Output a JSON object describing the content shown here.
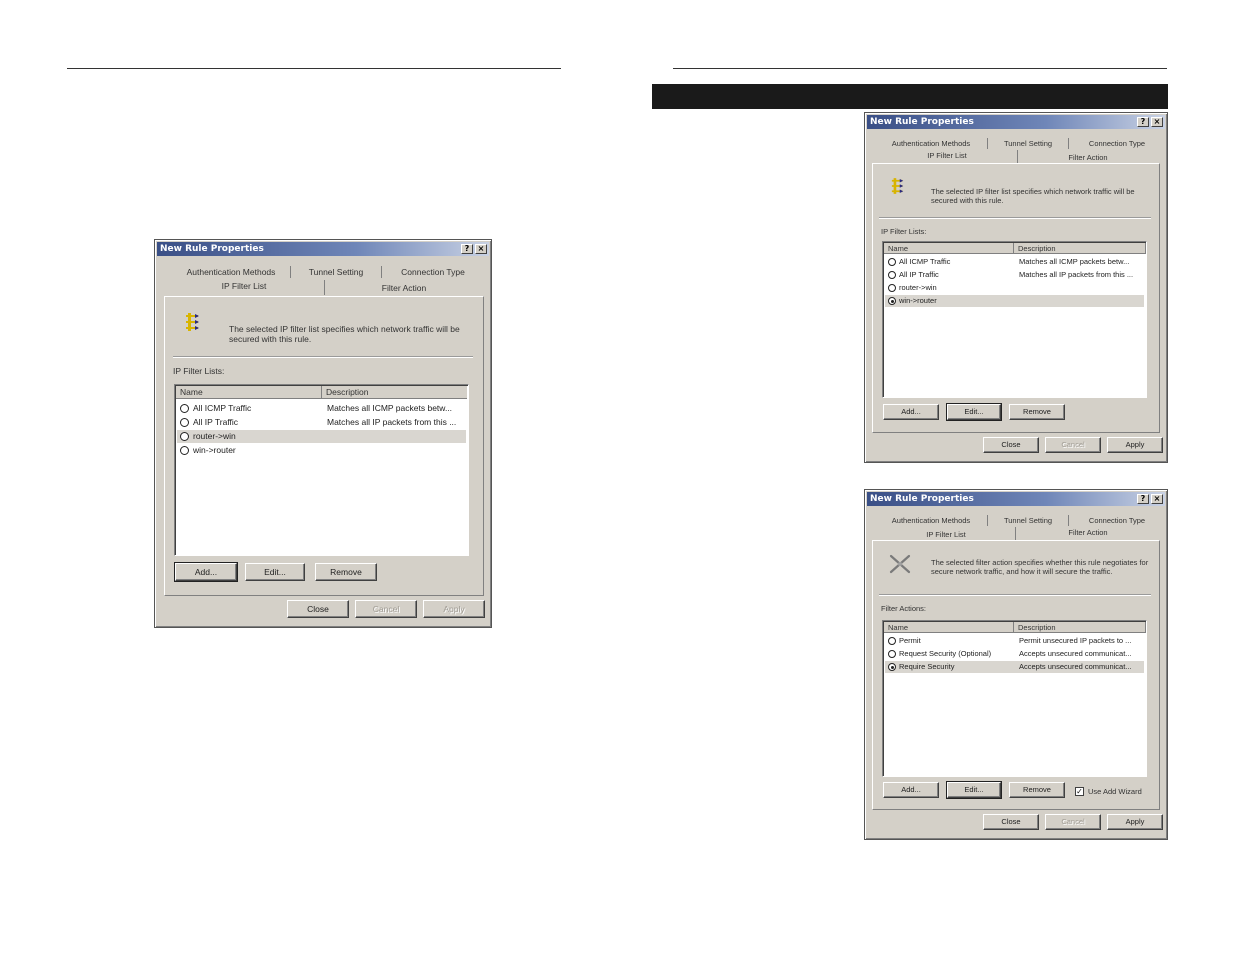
{
  "dialog_left": {
    "title": "New Rule Properties",
    "help_btn": "?",
    "close_btn": "×",
    "tabs_row1": [
      "Authentication Methods",
      "Tunnel Setting",
      "Connection Type"
    ],
    "tabs_row2": [
      "IP Filter List",
      "Filter Action"
    ],
    "icon": "ip-filter-list-icon",
    "description": "The selected IP filter list specifies which network traffic will be secured with this rule.",
    "list_label": "IP Filter Lists:",
    "columns": [
      "Name",
      "Description"
    ],
    "rows": [
      {
        "name": "All ICMP Traffic",
        "desc": "Matches all ICMP packets betw..."
      },
      {
        "name": "All IP Traffic",
        "desc": "Matches all IP packets from this ..."
      },
      {
        "name": "router->win",
        "desc": ""
      },
      {
        "name": "win->router",
        "desc": ""
      }
    ],
    "buttons": [
      "Add...",
      "Edit...",
      "Remove"
    ],
    "footer_buttons": [
      "Close",
      "Cancel",
      "Apply"
    ]
  },
  "dialog_right_top": {
    "title": "New Rule Properties",
    "help_btn": "?",
    "close_btn": "×",
    "tabs_row1": [
      "Authentication Methods",
      "Tunnel Setting",
      "Connection Type"
    ],
    "tabs_row2": [
      "IP Filter List",
      "Filter Action"
    ],
    "icon": "ip-filter-list-icon",
    "description": "The selected IP filter list specifies which network traffic will be secured with this rule.",
    "list_label": "IP Filter Lists:",
    "columns": [
      "Name",
      "Description"
    ],
    "rows": [
      {
        "name": "All ICMP Traffic",
        "desc": "Matches all ICMP packets betw..."
      },
      {
        "name": "All IP Traffic",
        "desc": "Matches all IP packets from this ..."
      },
      {
        "name": "router->win",
        "desc": ""
      },
      {
        "name": "win->router",
        "desc": ""
      }
    ],
    "buttons": [
      "Add...",
      "Edit...",
      "Remove"
    ],
    "footer_buttons": [
      "Close",
      "Cancel",
      "Apply"
    ]
  },
  "dialog_right_bottom": {
    "title": "New Rule Properties",
    "help_btn": "?",
    "close_btn": "×",
    "tabs_row1": [
      "Authentication Methods",
      "Tunnel Setting",
      "Connection Type"
    ],
    "tabs_row2": [
      "IP Filter List",
      "Filter Action"
    ],
    "icon": "filter-action-icon",
    "description": "The selected filter action specifies whether this rule negotiates for secure network traffic, and how it will secure the traffic.",
    "list_label": "Filter Actions:",
    "columns": [
      "Name",
      "Description"
    ],
    "rows": [
      {
        "name": "Permit",
        "desc": "Permit unsecured IP packets to ..."
      },
      {
        "name": "Request Security (Optional)",
        "desc": "Accepts unsecured communicat..."
      },
      {
        "name": "Require Security",
        "desc": "Accepts unsecured communicat..."
      }
    ],
    "buttons": [
      "Add...",
      "Edit...",
      "Remove"
    ],
    "checkbox_label": "Use Add Wizard",
    "footer_buttons": [
      "Close",
      "Cancel",
      "Apply"
    ]
  }
}
